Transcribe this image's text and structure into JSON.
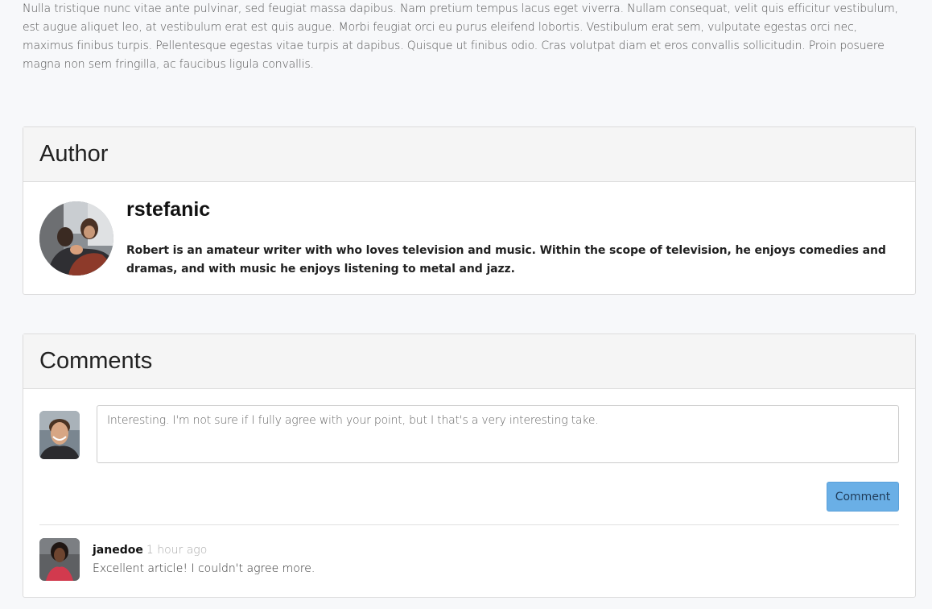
{
  "article": {
    "paragraph": "Nulla tristique nunc vitae ante pulvinar, sed feugiat massa dapibus. Nam pretium tempus lacus eget viverra. Nullam consequat, velit quis efficitur vestibulum, est augue aliquet leo, at vestibulum erat est quis augue. Morbi feugiat orci eu purus eleifend lobortis. Vestibulum erat sem, vulputate egestas orci nec, maximus finibus turpis. Pellentesque egestas vitae turpis at dapibus. Quisque ut finibus odio. Cras volutpat diam et eros convallis sollicitudin. Proin posuere magna non sem fringilla, ac faucibus ligula convallis."
  },
  "author_section": {
    "heading": "Author",
    "name": "rstefanic",
    "bio": "Robert is an amateur writer with who loves television and music. Within the scope of television, he enjoys comedies and dramas, and with music he enjoys listening to metal and jazz."
  },
  "comments_section": {
    "heading": "Comments",
    "input_value": "Interesting. I'm not sure if I fully agree with your point, but I that's a very interesting take.",
    "submit_label": "Comment",
    "comments": [
      {
        "author": "janedoe",
        "time": "1 hour ago",
        "text": "Excellent article! I couldn't agree more."
      }
    ]
  },
  "colors": {
    "accent_button": "#6aafe6",
    "page_background": "#f7f8fa"
  }
}
